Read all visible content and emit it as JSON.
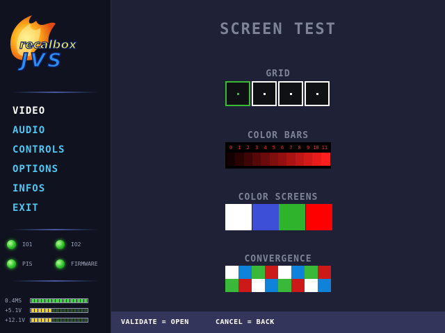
{
  "logo": {
    "line1": "recalbox",
    "line2": "JVS"
  },
  "menu": [
    {
      "label": "VIDEO",
      "active": true,
      "name": "menu-video"
    },
    {
      "label": "AUDIO",
      "active": false,
      "name": "menu-audio"
    },
    {
      "label": "CONTROLS",
      "active": false,
      "name": "menu-controls"
    },
    {
      "label": "OPTIONS",
      "active": false,
      "name": "menu-options"
    },
    {
      "label": "INFOS",
      "active": false,
      "name": "menu-infos"
    },
    {
      "label": "EXIT",
      "active": false,
      "name": "menu-exit"
    }
  ],
  "status": [
    {
      "label": "IO1",
      "color": "#3bd234"
    },
    {
      "label": "IO2",
      "color": "#3bd234"
    },
    {
      "label": "PIS",
      "color": "#3bd234"
    },
    {
      "label": "FIRMWARE",
      "color": "#3bd234"
    }
  ],
  "voltages": [
    {
      "label": "0.4MS",
      "level": 1.0,
      "color": "green"
    },
    {
      "label": "+5.1V",
      "level": 0.35,
      "color": "yellow"
    },
    {
      "label": "+12.1V",
      "level": 0.35,
      "color": "yellow"
    }
  ],
  "main": {
    "title": "SCREEN TEST",
    "grid_label": "GRID",
    "grid_selected_index": 0,
    "grid_count": 4,
    "color_bars_label": "COLOR BARS",
    "color_bar_numbers": [
      "0",
      "1",
      "2",
      "3",
      "4",
      "5",
      "6",
      "7",
      "8",
      "9",
      "10",
      "11"
    ],
    "color_bar_base": "#ff1e1e",
    "color_screens_label": "COLOR SCREENS",
    "color_screens": [
      "#ffffff",
      "#3d4fd6",
      "#2fb22c",
      "#ff0000"
    ],
    "convergence_label": "CONVERGENCE",
    "convergence_rows": [
      [
        "#ffffff",
        "#0e83d9",
        "#3ab83a",
        "#cc1a1a",
        "#ffffff",
        "#0e83d9",
        "#3ab83a",
        "#cc1a1a"
      ],
      [
        "#3ab83a",
        "#cc1a1a",
        "#ffffff",
        "#0e83d9",
        "#3ab83a",
        "#cc1a1a",
        "#ffffff",
        "#0e83d9"
      ]
    ]
  },
  "footer": {
    "validate": "VALIDATE = OPEN",
    "cancel": "CANCEL = BACK"
  }
}
